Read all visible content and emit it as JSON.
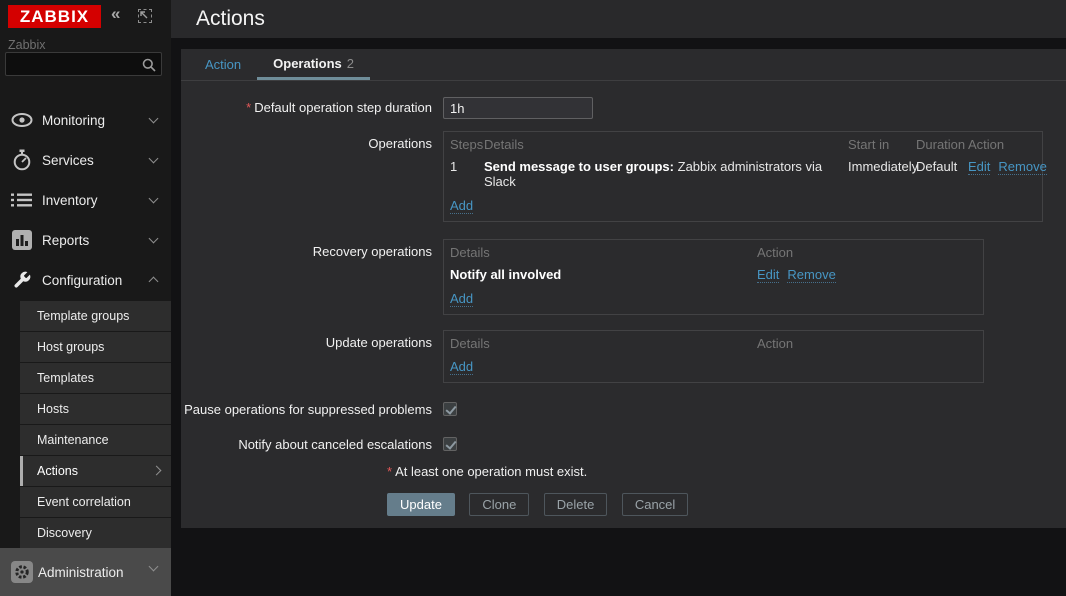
{
  "brand": {
    "logo": "ZABBIX",
    "server_name": "Zabbix"
  },
  "sidebar": {
    "menu": [
      "Monitoring",
      "Services",
      "Inventory",
      "Reports",
      "Configuration"
    ],
    "submenu": [
      "Template groups",
      "Host groups",
      "Templates",
      "Hosts",
      "Maintenance",
      "Actions",
      "Event correlation",
      "Discovery"
    ],
    "selected_submenu": "Actions",
    "admin_label": "Administration"
  },
  "header": {
    "title": "Actions"
  },
  "tabs": {
    "action": "Action",
    "operations": "Operations",
    "operations_count": "2"
  },
  "form": {
    "step_duration_label": "Default operation step duration",
    "step_duration_value": "1h",
    "operations_label": "Operations",
    "operations_headers": {
      "steps": "Steps",
      "details": "Details",
      "start_in": "Start in",
      "duration": "Duration",
      "action": "Action"
    },
    "operations_row": {
      "steps": "1",
      "details_bold": "Send message to user groups:",
      "details_text": "Zabbix administrators via Slack",
      "start_in": "Immediately",
      "duration": "Default",
      "edit": "Edit",
      "remove": "Remove"
    },
    "add_label": "Add",
    "recovery_label": "Recovery operations",
    "recovery_headers": {
      "details": "Details",
      "action": "Action"
    },
    "recovery_row": {
      "details_bold": "Notify all involved",
      "edit": "Edit",
      "remove": "Remove"
    },
    "update_label": "Update operations",
    "update_headers": {
      "details": "Details",
      "action": "Action"
    },
    "pause_label": "Pause operations for suppressed problems",
    "notify_label": "Notify about canceled escalations",
    "validation": "At least one operation must exist.",
    "buttons": {
      "update": "Update",
      "clone": "Clone",
      "delete": "Delete",
      "cancel": "Cancel"
    }
  },
  "colors": {
    "accent_red": "#d40000",
    "link_blue": "#4796c4",
    "tab_underline": "#6f8d99",
    "panel_bg": "#2b2b2d",
    "required_red": "#e45959"
  }
}
